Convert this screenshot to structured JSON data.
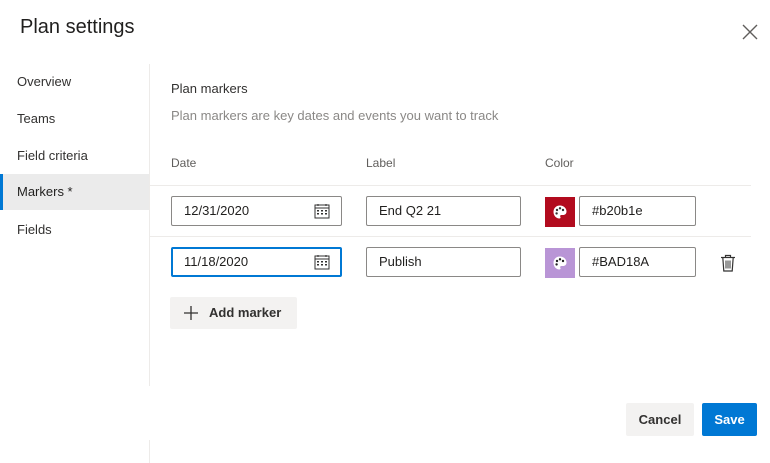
{
  "dialog": {
    "title": "Plan settings"
  },
  "nav": {
    "items": [
      {
        "label": "Overview"
      },
      {
        "label": "Teams"
      },
      {
        "label": "Field criteria"
      },
      {
        "label": "Markers *",
        "active": true
      },
      {
        "label": "Fields"
      }
    ]
  },
  "markers": {
    "title": "Plan markers",
    "description": "Plan markers are key dates and events you want to track",
    "columns": {
      "date": "Date",
      "label": "Label",
      "color": "Color"
    },
    "rows": [
      {
        "date": "12/31/2020",
        "label": "End Q2 21",
        "color": "#b20b1e",
        "swatch": "#b20b1e"
      },
      {
        "date": "11/18/2020",
        "label": "Publish",
        "color": "#BAD18A",
        "swatch": "#b995d6"
      }
    ],
    "add_label": "Add marker"
  },
  "footer": {
    "cancel_label": "Cancel",
    "save_label": "Save"
  },
  "colors": {
    "accent": "#0078d4",
    "nav_active_bg": "#ebebeb"
  },
  "icons": [
    "close-icon",
    "calendar-icon",
    "palette-icon",
    "trash-icon",
    "plus-icon"
  ]
}
